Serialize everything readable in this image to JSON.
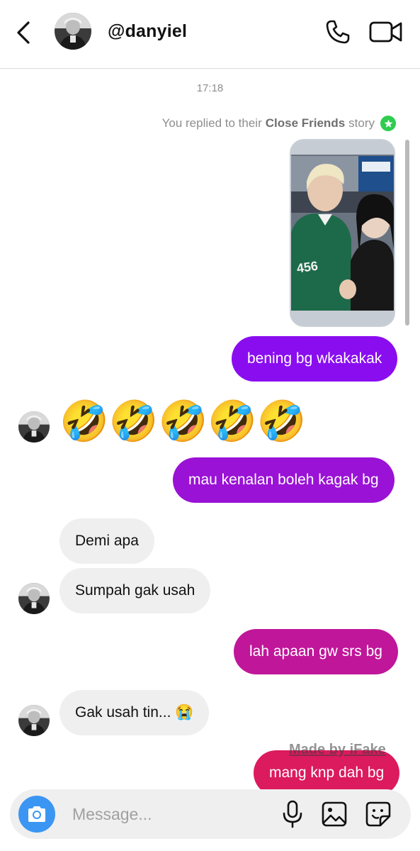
{
  "header": {
    "username": "@danyiel"
  },
  "conversation": {
    "timestamp": "17:18",
    "story_reply": {
      "prefix": "You replied to their",
      "highlight": "Close Friends",
      "suffix": "story",
      "badge_icon": "star-icon",
      "badge_color": "#2ecc4f"
    },
    "messages": [
      {
        "from": "me",
        "text": "bening bg wkakakak",
        "color": "#8a0df0"
      },
      {
        "from": "them",
        "text": "🤣🤣🤣🤣🤣",
        "type": "emoji"
      },
      {
        "from": "me",
        "text": "mau kenalan boleh kagak bg",
        "color": "#9a12d6"
      },
      {
        "from": "them",
        "text": "Demi apa"
      },
      {
        "from": "them",
        "text": "Sumpah gak usah"
      },
      {
        "from": "me",
        "text": "lah apaan gw srs bg",
        "color": "#c0169a"
      },
      {
        "from": "them",
        "text": "Gak usah tin... 😭"
      },
      {
        "from": "me",
        "text": "mang knp dah bg",
        "color": "#dc1a5e"
      }
    ]
  },
  "watermark": "Made by iFake",
  "composer": {
    "placeholder": "Message...",
    "camera_icon": "camera-icon",
    "accent": "#3b96f3"
  }
}
